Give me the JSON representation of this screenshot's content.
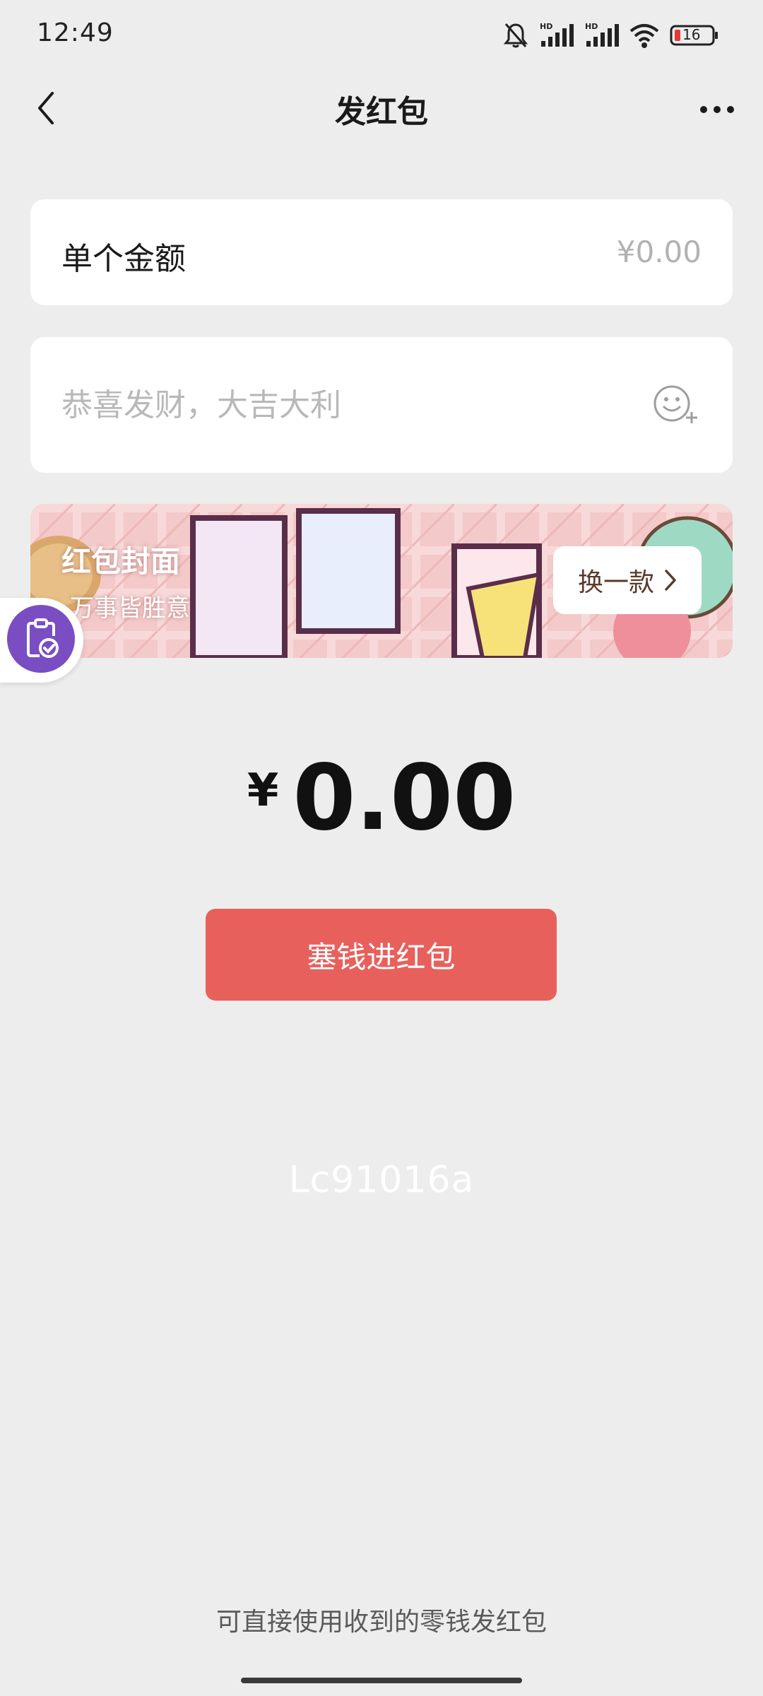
{
  "status_bar": {
    "time": "12:49",
    "battery": "16",
    "icons": [
      "mute-bell-icon",
      "hd-signal-icon",
      "hd-signal-icon",
      "wifi-icon",
      "battery-icon"
    ]
  },
  "nav": {
    "title": "发红包",
    "back_icon": "chevron-left-icon",
    "more_icon": "more-dots-icon"
  },
  "amount": {
    "label": "单个金额",
    "value": "¥0.00"
  },
  "message": {
    "placeholder": "恭喜发财，大吉大利",
    "emoji_icon": "emoji-add-icon"
  },
  "cover": {
    "title": "红包封面",
    "subtitle": "万事皆胜意",
    "change_label": "换一款"
  },
  "total": {
    "symbol": "¥",
    "value": "0.00"
  },
  "primary_button": {
    "label": "塞钱进红包"
  },
  "watermark": "Lc91016a",
  "footer": {
    "note": "可直接使用收到的零钱发红包"
  },
  "colors": {
    "background": "#ededed",
    "primary_button": "#e8605c",
    "float_circle": "#7a4dc3"
  }
}
